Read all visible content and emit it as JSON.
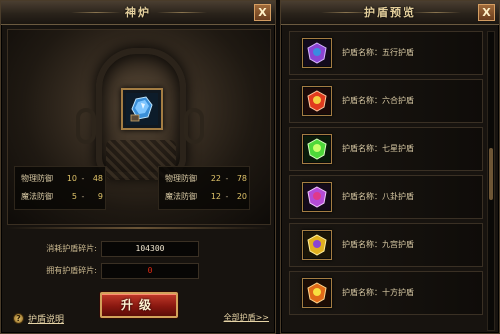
{
  "furnace_panel": {
    "title": "神炉",
    "close_label": "X",
    "stats_left": [
      {
        "name": "物理防御",
        "min": "10",
        "dash": "-",
        "max": "48"
      },
      {
        "name": "魔法防御",
        "min": "5",
        "dash": "-",
        "max": "9"
      }
    ],
    "stats_right": [
      {
        "name": "物理防御",
        "min": "22",
        "dash": "-",
        "max": "78"
      },
      {
        "name": "魔法防御",
        "min": "12",
        "dash": "-",
        "max": "20"
      }
    ],
    "fragments_label": "消耗护盾碎片:",
    "fragments_value": "104300",
    "owned_label": "拥有护盾碎片:",
    "owned_value": "0",
    "upgrade_label": "升级",
    "help_icon": "?",
    "help_label": "护盾说明",
    "all_shields_label": "全部护盾>>"
  },
  "preview_panel": {
    "title": "护盾预览",
    "close_label": "X",
    "items": [
      {
        "label": "护盾名称：五行护盾",
        "icon": "purple-shield-icon",
        "color": "#8a44d4"
      },
      {
        "label": "护盾名称：六合护盾",
        "icon": "red-shield-icon",
        "color": "#e03a1e"
      },
      {
        "label": "护盾名称：七星护盾",
        "icon": "green-shield-icon",
        "color": "#4ed83a"
      },
      {
        "label": "护盾名称：八卦护盾",
        "icon": "violet-shield-icon",
        "color": "#b44bd8"
      },
      {
        "label": "护盾名称：九宫护盾",
        "icon": "gold-shield-icon",
        "color": "#e0b020"
      },
      {
        "label": "护盾名称：十方护盾",
        "icon": "fire-shield-icon",
        "color": "#e06a18"
      }
    ]
  },
  "colors": {
    "accent_gold": "#a47d43",
    "upgrade_red": "#8a1810",
    "owned_red": "#e02a14",
    "stat_value": "#e0c46a"
  }
}
